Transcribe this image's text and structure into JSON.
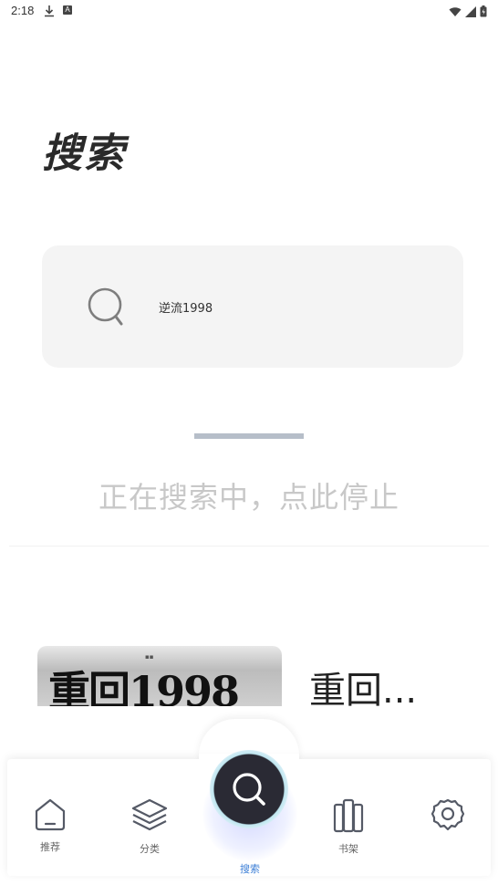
{
  "status_bar": {
    "time": "2:18",
    "badge": "A"
  },
  "page": {
    "title": "搜索"
  },
  "search": {
    "query": "逆流1998"
  },
  "search_status": {
    "progress_fraction": 0.5,
    "text": "正在搜索中，点此停止"
  },
  "results": [
    {
      "cover_text": "重回1998",
      "title": "重回..."
    }
  ],
  "bottom_nav": {
    "items": [
      {
        "label": "推荐",
        "icon": "home-icon"
      },
      {
        "label": "分类",
        "icon": "layers-icon"
      },
      {
        "label": "搜索",
        "icon": "search-icon",
        "active": true
      },
      {
        "label": "书架",
        "icon": "bookshelf-icon"
      },
      {
        "label": "",
        "icon": "settings-icon"
      }
    ]
  },
  "colors": {
    "accent": "#3d7fd6",
    "progress": "#b6bec9",
    "muted_text": "#c8c8c8"
  }
}
